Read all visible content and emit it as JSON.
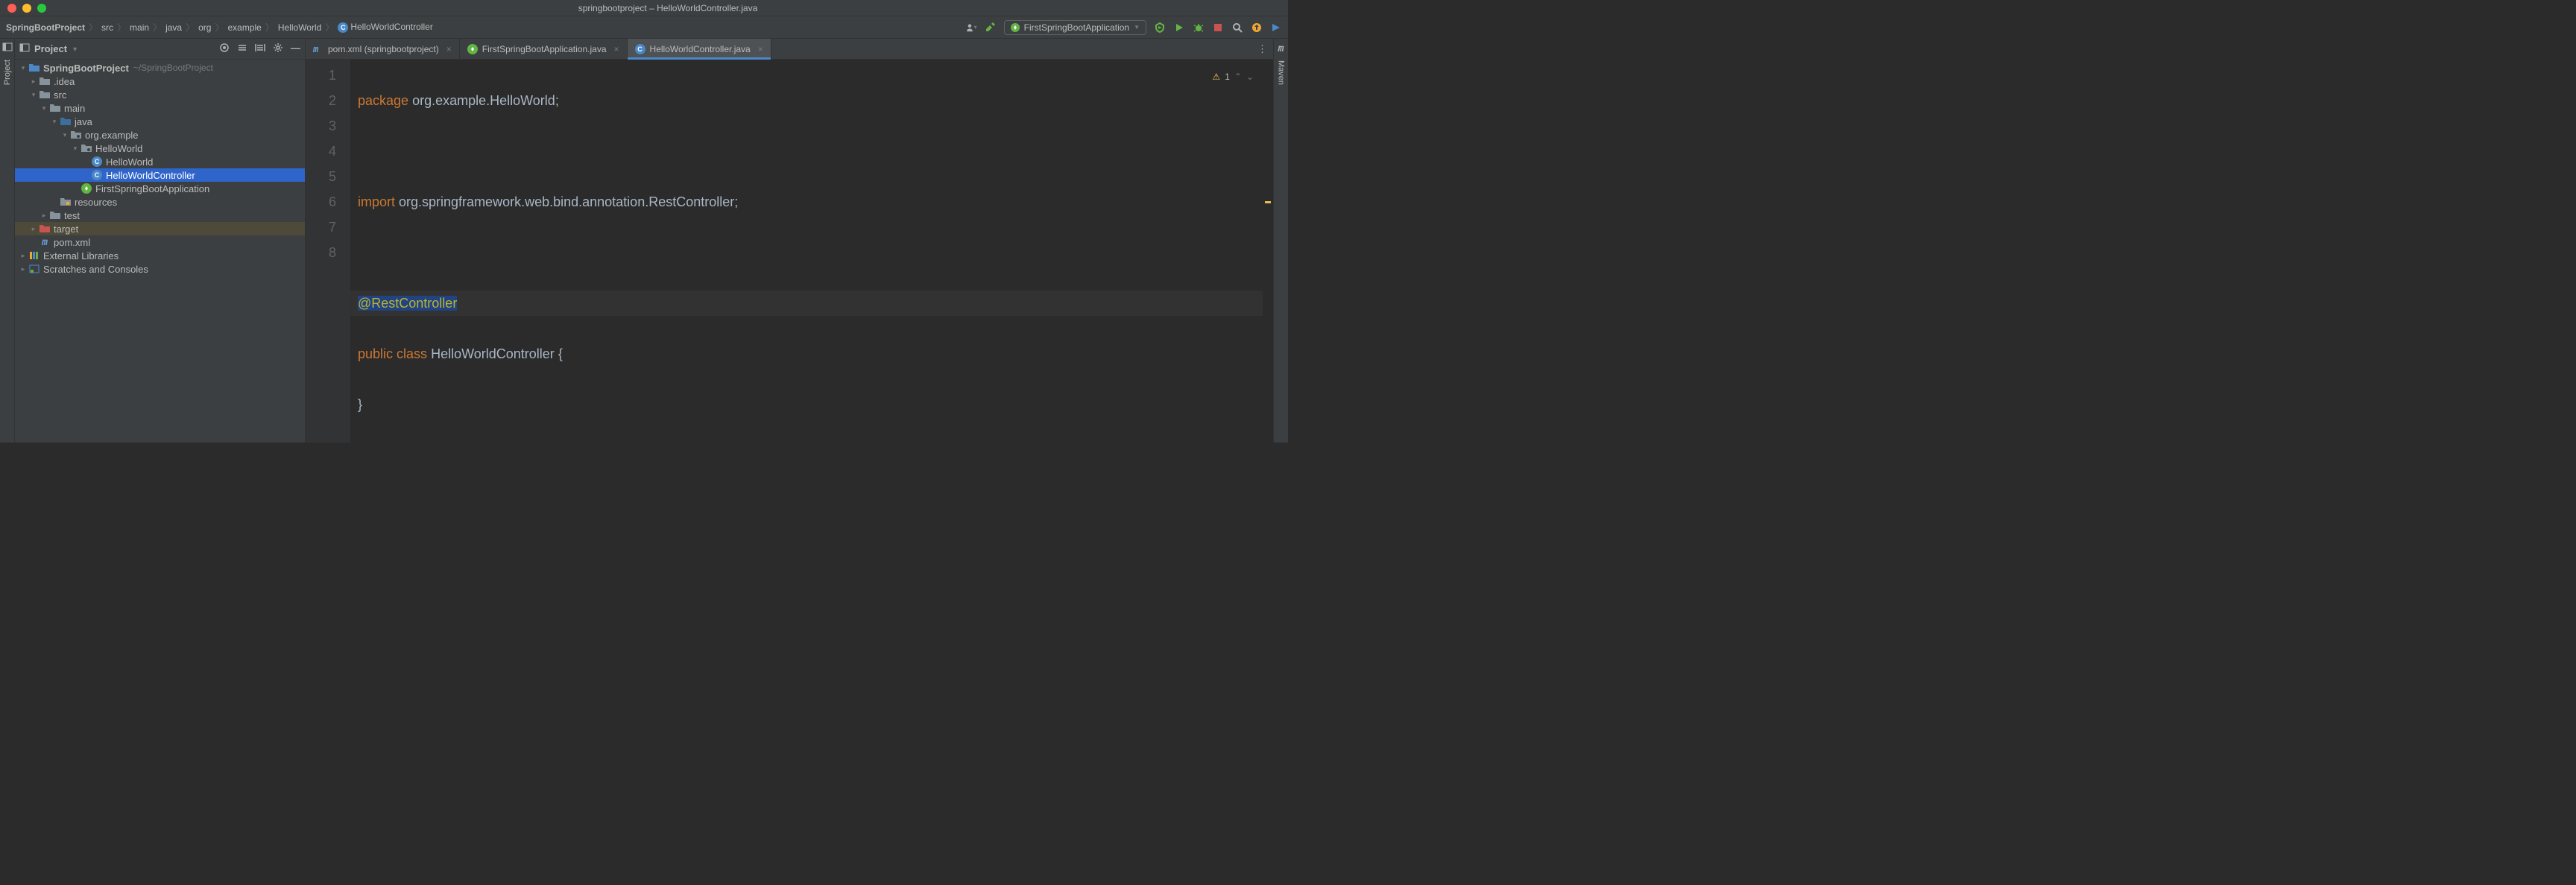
{
  "title": "springbootproject – HelloWorldController.java",
  "breadcrumbs": [
    "SpringBootProject",
    "src",
    "main",
    "java",
    "org",
    "example",
    "HelloWorld",
    "HelloWorldController"
  ],
  "runConfig": "FirstSpringBootApplication",
  "inspectionCount": "1",
  "sidebar": {
    "title": "Project",
    "leftGutter": "Project",
    "rightGutter": "Maven",
    "tree": {
      "root": "SpringBootProject",
      "rootPath": "~/SpringBootProject",
      "idea": ".idea",
      "src": "src",
      "main": "main",
      "javaDir": "java",
      "pkg": "org.example",
      "hwPkg": "HelloWorld",
      "hwClass": "HelloWorld",
      "hwCtrl": "HelloWorldController",
      "appClass": "FirstSpringBootApplication",
      "resources": "resources",
      "test": "test",
      "target": "target",
      "pom": "pom.xml",
      "ext": "External Libraries",
      "scratch": "Scratches and Consoles"
    }
  },
  "tabs": [
    {
      "label": "pom.xml (springbootproject)",
      "icon": "m",
      "active": false
    },
    {
      "label": "FirstSpringBootApplication.java",
      "icon": "sb",
      "active": false
    },
    {
      "label": "HelloWorldController.java",
      "icon": "c",
      "active": true
    }
  ],
  "editor": {
    "lines": [
      "1",
      "2",
      "3",
      "4",
      "5",
      "6",
      "7",
      "8"
    ],
    "l1_kw": "package",
    "l1_rest": " org.example.HelloWorld;",
    "l3_kw": "import",
    "l3_mid": " org.springframework.web.bind.annotation.",
    "l3_cls": "RestController",
    "l3_end": ";",
    "l5": "@RestController",
    "l6_kw1": "public",
    "l6_kw2": "class",
    "l6_cls": "HelloWorldController",
    "l6_end": " {",
    "l7": "}"
  }
}
